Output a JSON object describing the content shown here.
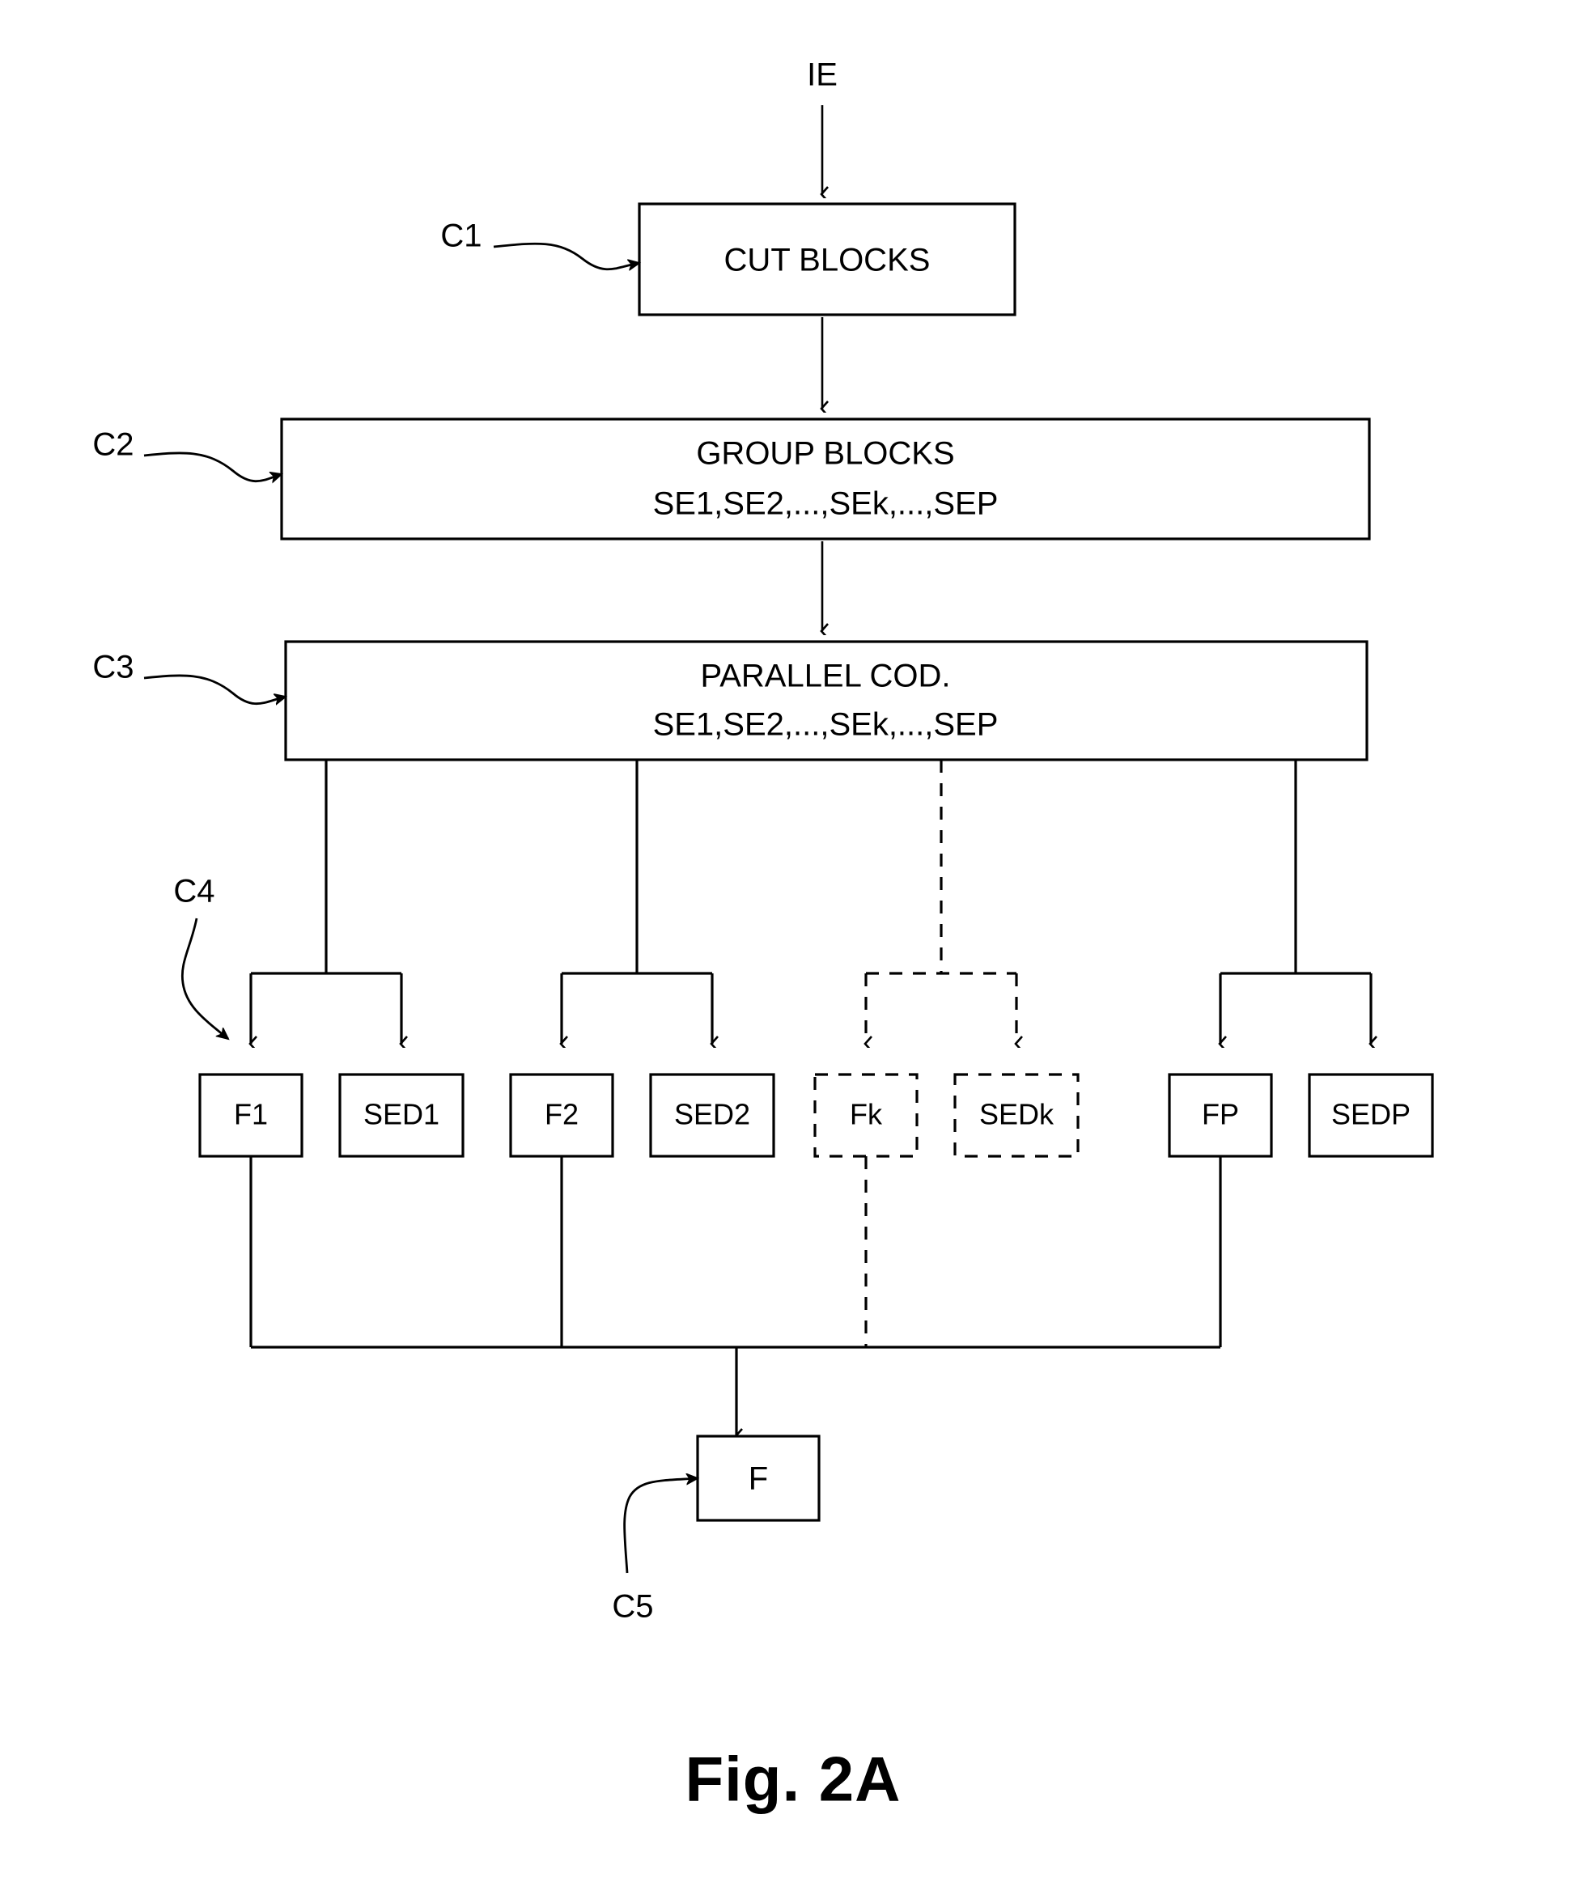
{
  "figure": {
    "caption": "Fig. 2A",
    "input_label": "IE"
  },
  "stages": [
    {
      "ref": "C1",
      "title": "CUT BLOCKS",
      "subtitle": ""
    },
    {
      "ref": "C2",
      "title": "GROUP BLOCKS",
      "subtitle": "SE1,SE2,...,SEk,...,SEP"
    },
    {
      "ref": "C3",
      "title": "PARALLEL COD.",
      "subtitle": "SE1,SE2,...,SEk,...,SEP"
    }
  ],
  "branch_group": {
    "ref": "C4",
    "branches": [
      {
        "flux": "F1",
        "sed": "SED1",
        "style": "solid"
      },
      {
        "flux": "F2",
        "sed": "SED2",
        "style": "solid"
      },
      {
        "flux": "Fk",
        "sed": "SEDk",
        "style": "dashed"
      },
      {
        "flux": "FP",
        "sed": "SEDP",
        "style": "solid"
      }
    ]
  },
  "output": {
    "ref": "C5",
    "label": "F"
  }
}
